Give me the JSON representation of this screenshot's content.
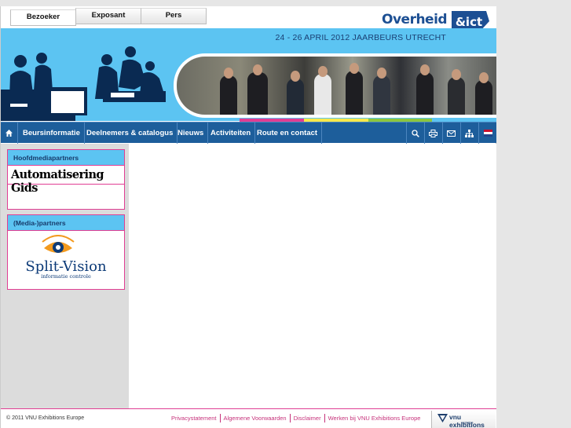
{
  "tabs": [
    {
      "label": "Bezoeker"
    },
    {
      "label": "Exposant"
    },
    {
      "label": "Pers"
    }
  ],
  "logo": {
    "text": "Overheid",
    "badge": "&ict"
  },
  "banner": {
    "date": "24 - 26 APRIL 2012 JAARBEURS UTRECHT"
  },
  "nav": {
    "items": [
      "Beursinformatie",
      "Deelnemers & catalogus",
      "Nieuws",
      "Activiteiten",
      "Route en contact"
    ],
    "icons": [
      "home-icon",
      "search-icon",
      "print-icon",
      "mail-icon",
      "sitemap-icon",
      "flag-nl-icon"
    ]
  },
  "colors": {
    "sky": "#5cc4f2",
    "navy": "#1d5e9b",
    "pink": "#e03e93",
    "stripe": [
      "#e03e93",
      "#f7e84b",
      "#8cc63f",
      "#5cc4f2"
    ]
  },
  "sidebar": {
    "box1": {
      "title": "Hoofdmediapartners",
      "sponsor": "Automatisering Gids"
    },
    "box2": {
      "title": "(Media-)partners",
      "sponsor": "Split-Vision",
      "sponsor_sub": "informatie controle"
    }
  },
  "footer": {
    "copyright": "© 2011 VNU Exhibitions Europe",
    "links": [
      "Privacystatement",
      "Algemene Voorwaarden",
      "Disclaimer",
      "Werken bij VNU Exhibitions Europe"
    ],
    "brand": "vnu exhibitions",
    "brand_sub": "europe"
  }
}
